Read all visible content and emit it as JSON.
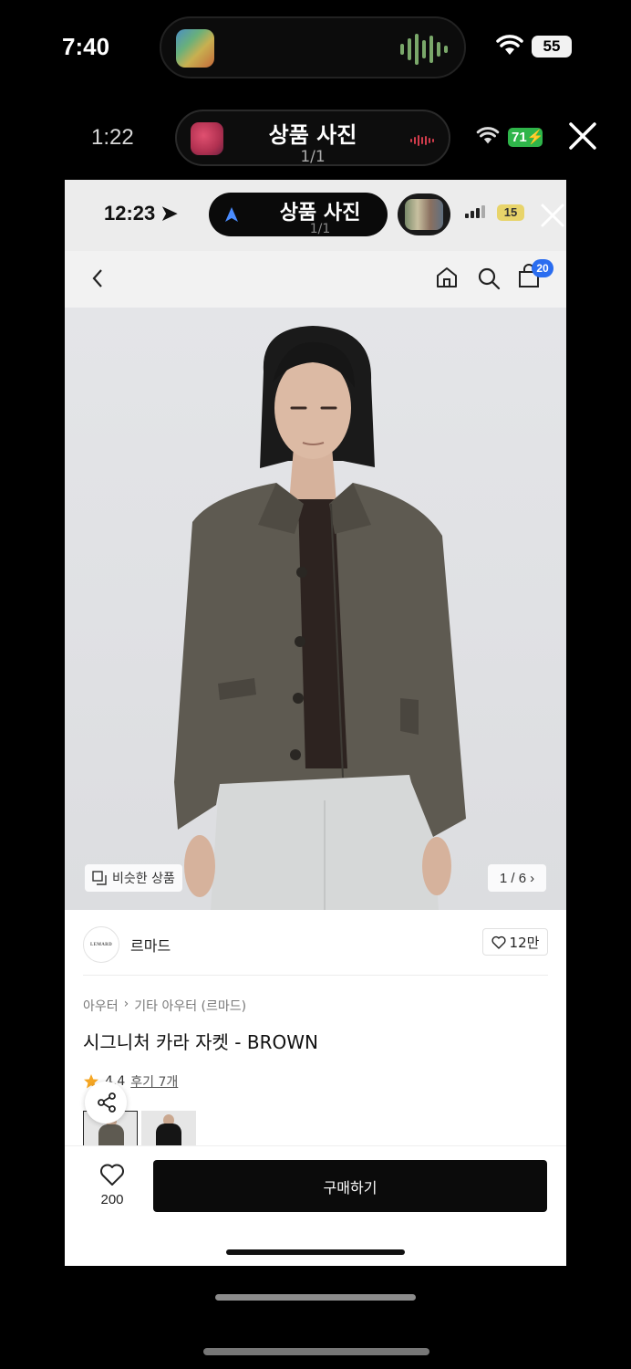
{
  "outer_status": {
    "time": "7:40",
    "battery": "55"
  },
  "viewer_status": {
    "time": "1:22",
    "title": "상품 사진",
    "page": "1/1",
    "battery": "71"
  },
  "inner_status": {
    "time": "12:23",
    "island_title": "상품 사진",
    "island_page": "1/1",
    "battery": "15"
  },
  "nav": {
    "cart_count": "20"
  },
  "photo": {
    "similar_label": "비슷한 상품",
    "pager": "1 / 6"
  },
  "brand": {
    "logo_text": "LEMARD",
    "name": "르마드",
    "likes": "12만"
  },
  "product": {
    "breadcrumb": [
      "아우터",
      "기타 아우터 (르마드)"
    ],
    "title": "시그니처 카라 자켓 - BROWN",
    "rating": "4.4",
    "reviews": "후기 7개"
  },
  "bottom": {
    "wish_count": "200",
    "buy_label": "구매하기"
  },
  "colors": {
    "accent_badge": "#2a6df0",
    "buy_button": "#0b0b0b",
    "jacket": "#5f5a50"
  }
}
